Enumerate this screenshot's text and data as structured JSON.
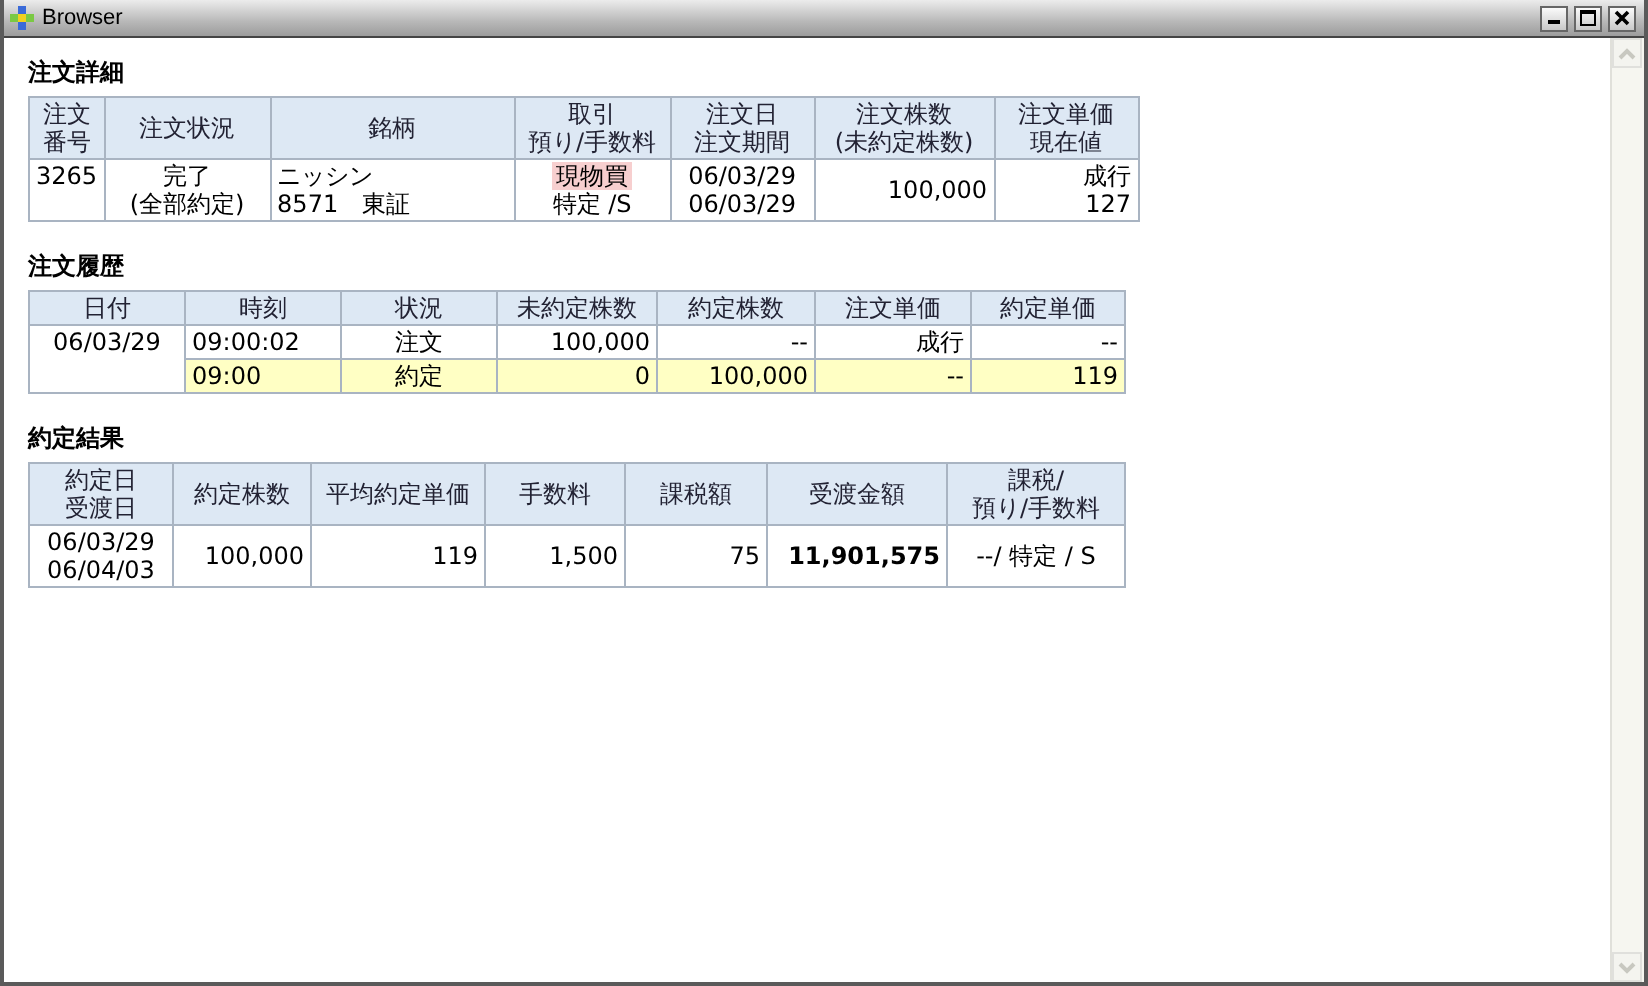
{
  "window": {
    "title": "Browser"
  },
  "order_detail": {
    "title": "注文詳細",
    "columns": [
      [
        "注文",
        "番号"
      ],
      [
        "注文状況"
      ],
      [
        "銘柄"
      ],
      [
        "取引",
        "預り/手数料"
      ],
      [
        "注文日",
        "注文期間"
      ],
      [
        "注文株数",
        "(未約定株数)"
      ],
      [
        "注文単価",
        "現在値"
      ]
    ],
    "row": [
      {
        "lines": [
          "3265"
        ]
      },
      {
        "lines": [
          "完了",
          "(全部約定)"
        ]
      },
      {
        "lines": [
          "ニッシン",
          "8571　東証"
        ]
      },
      {
        "tag": "現物買",
        "lines": [
          "特定 /S"
        ]
      },
      {
        "lines": [
          "06/03/29",
          "06/03/29"
        ]
      },
      {
        "lines": [
          "100,000"
        ]
      },
      {
        "lines": [
          "成行",
          "127"
        ]
      }
    ]
  },
  "order_history": {
    "title": "注文履歴",
    "columns": [
      "日付",
      "時刻",
      "状況",
      "未約定株数",
      "約定株数",
      "注文単価",
      "約定単価"
    ],
    "rows": [
      {
        "highlighted": false,
        "cells": [
          "06/03/29",
          "09:00:02",
          "注文",
          "100,000",
          "--",
          "成行",
          "--"
        ]
      },
      {
        "highlighted": true,
        "cells": [
          "",
          "09:00",
          "約定",
          "0",
          "100,000",
          "--",
          "119"
        ]
      }
    ]
  },
  "execution_result": {
    "title": "約定結果",
    "columns": [
      [
        "約定日",
        "受渡日"
      ],
      [
        "約定株数"
      ],
      [
        "平均約定単価"
      ],
      [
        "手数料"
      ],
      [
        "課税額"
      ],
      [
        "受渡金額"
      ],
      [
        "課税/",
        "預り/手数料"
      ]
    ],
    "row": [
      [
        "06/03/29",
        "06/04/03"
      ],
      [
        "100,000"
      ],
      [
        "119"
      ],
      [
        "1,500"
      ],
      [
        "75"
      ],
      [
        "11,901,575"
      ],
      [
        "--/ 特定 / S"
      ]
    ]
  }
}
